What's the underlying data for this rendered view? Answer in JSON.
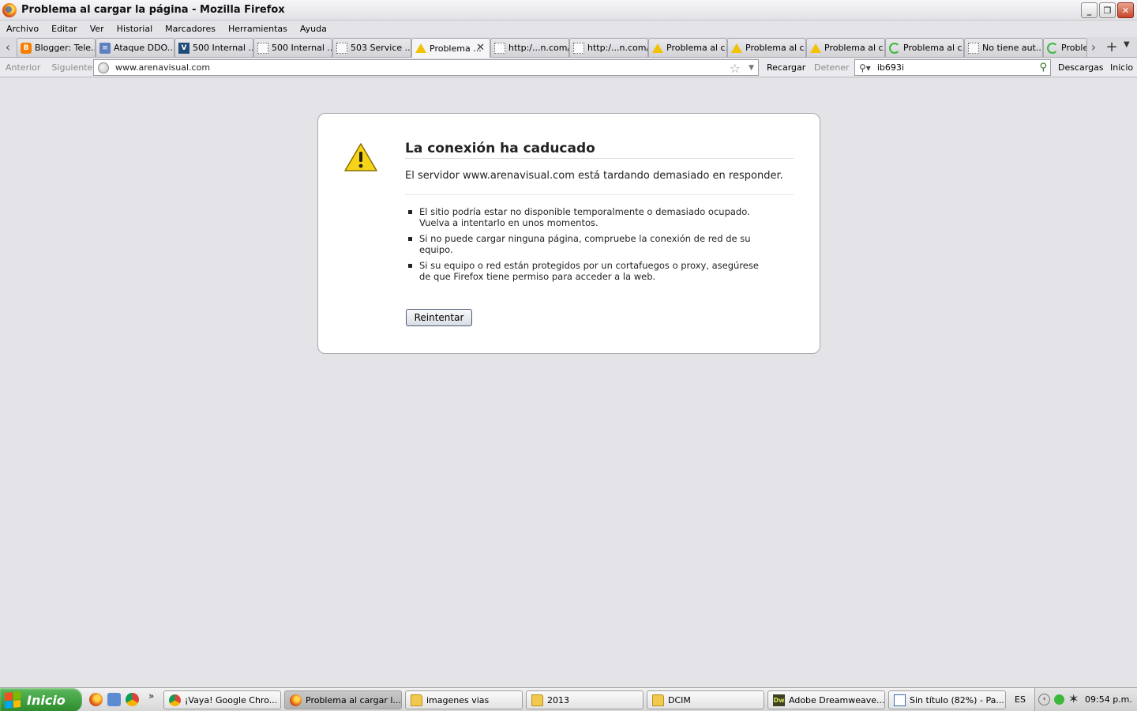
{
  "window": {
    "title": "Problema al cargar la página - Mozilla Firefox",
    "minimize": "_",
    "restore": "❐",
    "close": "✕"
  },
  "menu": [
    "Archivo",
    "Editar",
    "Ver",
    "Historial",
    "Marcadores",
    "Herramientas",
    "Ayuda"
  ],
  "tabs": [
    {
      "label": "Blogger: Tele...",
      "icon": "blogger-icon"
    },
    {
      "label": "Ataque DDO...",
      "icon": "doc-icon"
    },
    {
      "label": "500 Internal ...",
      "icon": "v-icon"
    },
    {
      "label": "500 Internal ...",
      "icon": "blank-page-icon"
    },
    {
      "label": "503 Service ...",
      "icon": "blank-page-icon"
    },
    {
      "label": "Problema ...",
      "icon": "warning-icon",
      "active": true
    },
    {
      "label": "http:/...n.com/",
      "icon": "blank-page-icon"
    },
    {
      "label": "http:/...n.com/",
      "icon": "blank-page-icon"
    },
    {
      "label": "Problema al c...",
      "icon": "warning-icon"
    },
    {
      "label": "Problema al c...",
      "icon": "warning-icon"
    },
    {
      "label": "Problema al c...",
      "icon": "warning-icon"
    },
    {
      "label": "Problema al c...",
      "icon": "loading-icon"
    },
    {
      "label": "No tiene aut...",
      "icon": "blank-page-icon"
    },
    {
      "label": "Proble",
      "icon": "loading-icon"
    }
  ],
  "tab_close": "✕",
  "tab_new": "+",
  "nav": {
    "back": "Anterior",
    "forward": "Siguiente",
    "url": "www.arenavisual.com",
    "reload": "Recargar",
    "stop": "Detener",
    "search_value": "ib693i",
    "downloads": "Descargas",
    "home": "Inicio"
  },
  "error": {
    "title": "La conexión ha caducado",
    "description": "El servidor www.arenavisual.com está tardando demasiado en responder.",
    "items": [
      "El sitio podría estar no disponible temporalmente o demasiado ocupado. Vuelva a intentarlo en unos momentos.",
      "Si no puede cargar ninguna página, compruebe la conexión de red de su equipo.",
      "Si su equipo o red están protegidos por un cortafuegos o proxy, asegúrese de que Firefox tiene permiso para acceder a la web."
    ],
    "retry": "Reintentar"
  },
  "taskbar": {
    "start": "Inicio",
    "more": "»",
    "tasks": [
      {
        "label": "¡Vaya! Google Chro...",
        "icon": "chrome-icon"
      },
      {
        "label": "Problema al cargar l...",
        "icon": "firefox-icon",
        "active": true
      },
      {
        "label": "imagenes vias",
        "icon": "folder-icon"
      },
      {
        "label": "2013",
        "icon": "folder-icon"
      },
      {
        "label": "DCIM",
        "icon": "folder-icon"
      },
      {
        "label": "Adobe Dreamweave...",
        "icon": "dreamweaver-icon"
      },
      {
        "label": "Sin título (82%) - Pa...",
        "icon": "paint-icon"
      }
    ],
    "language": "ES",
    "clock": "09:54 p.m."
  },
  "colors": {
    "accent_green": "#2c8a2c",
    "warning_yellow": "#f2c200"
  }
}
